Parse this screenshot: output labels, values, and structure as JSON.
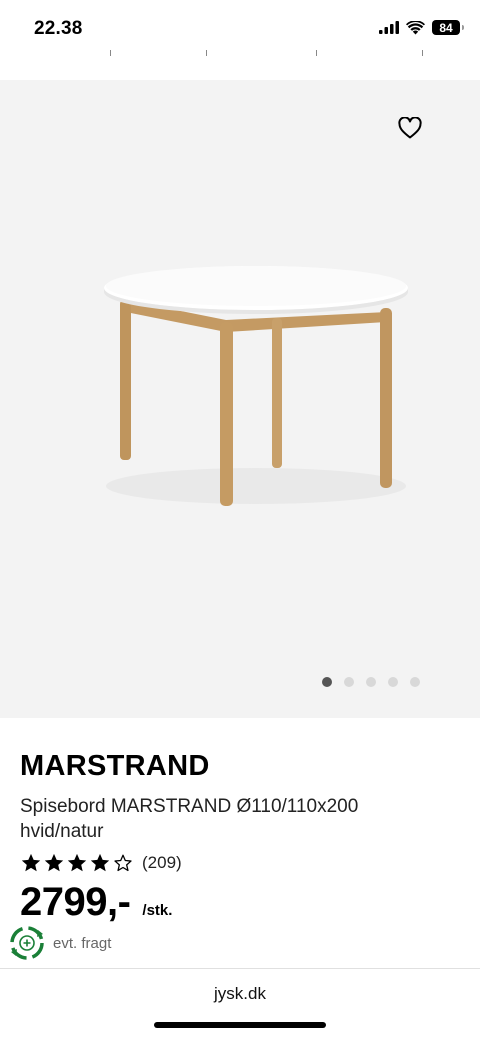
{
  "status": {
    "time": "22.38",
    "battery": "84"
  },
  "product": {
    "brand": "MARSTRAND",
    "name": "Spisebord MARSTRAND Ø110/110x200 hvid/natur",
    "rating_value": 4,
    "rating_max": 5,
    "rating_count": "(209)",
    "price": "2799,-",
    "unit": "/stk.",
    "shipping": "evt. fragt"
  },
  "gallery": {
    "current_image": 1,
    "image_count": 5
  },
  "browser": {
    "url": "jysk.dk"
  },
  "icons": {
    "favorite": "heart-outline-icon",
    "signal": "cellular-signal-icon",
    "wifi": "wifi-icon",
    "battery": "battery-icon",
    "shipping": "recycle-delivery-icon",
    "star_filled": "star-filled-icon",
    "star_empty": "star-outline-icon"
  },
  "colors": {
    "hero_bg": "#f3f3f3",
    "shipping_green": "#1a7f37",
    "text": "#000000"
  }
}
